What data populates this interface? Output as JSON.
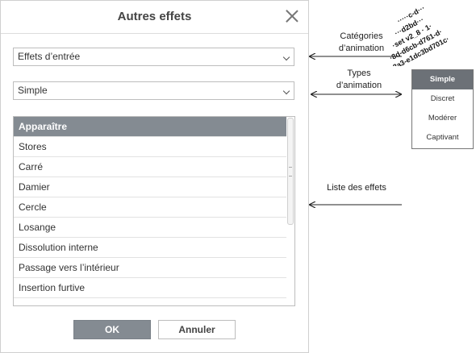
{
  "dialog": {
    "title": "Autres effets",
    "category_select": {
      "value": "Effets d’entrée"
    },
    "type_select": {
      "value": "Simple"
    },
    "effects": [
      {
        "label": "Apparaître",
        "selected": true
      },
      {
        "label": "Stores"
      },
      {
        "label": "Carré"
      },
      {
        "label": "Damier"
      },
      {
        "label": "Cercle"
      },
      {
        "label": "Losange"
      },
      {
        "label": "Dissolution interne"
      },
      {
        "label": "Passage vers l’intérieur"
      },
      {
        "label": "Insertion furtive"
      }
    ],
    "ok_label": "OK",
    "cancel_label": "Annuler"
  },
  "annotations": {
    "categories": [
      "Catégories",
      "d’animation"
    ],
    "types": [
      "Types",
      "d’animation"
    ],
    "effects_list": "Liste des effets"
  },
  "type_popup": {
    "items": [
      "Simple",
      "Discret",
      "Modérer",
      "Captivant"
    ],
    "active_index": 0
  },
  "colors": {
    "selected_row": "#848b92",
    "ok_button": "#848b92",
    "popup_active": "#6c7177"
  }
}
